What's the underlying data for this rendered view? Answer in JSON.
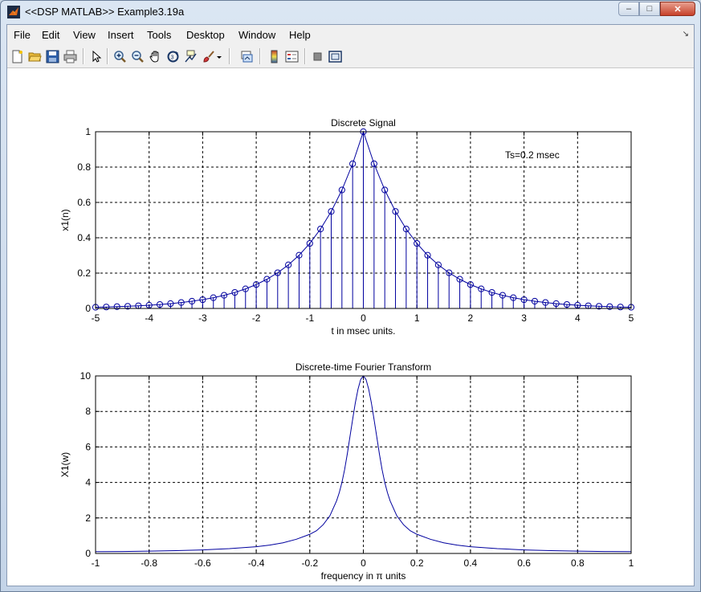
{
  "window": {
    "title": "<<DSP MATLAB>> Example3.19a",
    "controls": {
      "minimize": "–",
      "maximize": "□",
      "close": "✕"
    }
  },
  "menu": {
    "items": [
      "File",
      "Edit",
      "View",
      "Insert",
      "Tools",
      "Desktop",
      "Window",
      "Help"
    ],
    "overflow": "↘"
  },
  "toolbar": {
    "icons": [
      "new-figure-icon",
      "open-file-icon",
      "save-icon",
      "print-icon",
      "pointer-icon",
      "zoom-in-icon",
      "zoom-out-icon",
      "pan-hand-icon",
      "rotate-3d-icon",
      "data-cursor-icon",
      "brush-icon",
      "brush-dropdown-icon",
      "link-plot-icon",
      "colorbar-icon",
      "legend-icon",
      "hide-plot-tools-icon",
      "show-plot-tools-icon"
    ]
  },
  "colors": {
    "line": "#00009e",
    "axes": "#000000",
    "grid": "#000000"
  },
  "chart_data": [
    {
      "type": "stem",
      "title": "Discrete Signal",
      "xlabel": "t in msec units.",
      "ylabel": "x1(n)",
      "xlim": [
        -5,
        5
      ],
      "ylim": [
        0,
        1
      ],
      "xticks": [
        "-5",
        "-4",
        "-3",
        "-2",
        "-1",
        "0",
        "1",
        "2",
        "3",
        "4",
        "5"
      ],
      "yticks": [
        "0",
        "0.2",
        "0.4",
        "0.6",
        "0.8",
        "1"
      ],
      "grid": true,
      "annotation": "Ts=0.2 msec",
      "x": [
        -5.0,
        -4.8,
        -4.6,
        -4.4,
        -4.2,
        -4.0,
        -3.8,
        -3.6,
        -3.4,
        -3.2,
        -3.0,
        -2.8,
        -2.6,
        -2.4,
        -2.2,
        -2.0,
        -1.8,
        -1.6,
        -1.4,
        -1.2,
        -1.0,
        -0.8,
        -0.6,
        -0.4,
        -0.2,
        0.0,
        0.2,
        0.4,
        0.6,
        0.8,
        1.0,
        1.2,
        1.4,
        1.6,
        1.8,
        2.0,
        2.2,
        2.4,
        2.6,
        2.8,
        3.0,
        3.2,
        3.4,
        3.6,
        3.8,
        4.0,
        4.2,
        4.4,
        4.6,
        4.8,
        5.0
      ],
      "y": [
        0.0067,
        0.0082,
        0.0101,
        0.0123,
        0.015,
        0.0183,
        0.0224,
        0.0273,
        0.0334,
        0.0408,
        0.0498,
        0.0608,
        0.0743,
        0.0907,
        0.1108,
        0.1353,
        0.1653,
        0.2019,
        0.2466,
        0.3012,
        0.3679,
        0.4493,
        0.5488,
        0.6703,
        0.8187,
        1.0,
        0.8187,
        0.6703,
        0.5488,
        0.4493,
        0.3679,
        0.3012,
        0.2466,
        0.2019,
        0.1653,
        0.1353,
        0.1108,
        0.0907,
        0.0743,
        0.0608,
        0.0498,
        0.0408,
        0.0334,
        0.0273,
        0.0224,
        0.0183,
        0.015,
        0.0123,
        0.0101,
        0.0082,
        0.0067
      ]
    },
    {
      "type": "line",
      "title": "Discrete-time Fourier Transform",
      "xlabel": "frequency in π units",
      "ylabel": "X1(w)",
      "xlim": [
        -1,
        1
      ],
      "ylim": [
        0,
        10
      ],
      "xticks": [
        "-1",
        "-0.8",
        "-0.6",
        "-0.4",
        "-0.2",
        "0",
        "0.2",
        "0.4",
        "0.6",
        "0.8",
        "1"
      ],
      "yticks": [
        "0",
        "2",
        "4",
        "6",
        "8",
        "10"
      ],
      "grid": true,
      "x": [
        -1.0,
        -0.9,
        -0.8,
        -0.7,
        -0.6,
        -0.5,
        -0.4,
        -0.35,
        -0.3,
        -0.25,
        -0.2,
        -0.175,
        -0.15,
        -0.125,
        -0.1,
        -0.09,
        -0.08,
        -0.07,
        -0.06,
        -0.05,
        -0.04,
        -0.03,
        -0.02,
        -0.01,
        0.0,
        0.01,
        0.02,
        0.03,
        0.04,
        0.05,
        0.06,
        0.07,
        0.08,
        0.09,
        0.1,
        0.125,
        0.15,
        0.175,
        0.2,
        0.25,
        0.3,
        0.35,
        0.4,
        0.5,
        0.6,
        0.7,
        0.8,
        0.9,
        1.0
      ],
      "y": [
        0.1,
        0.11,
        0.13,
        0.16,
        0.2,
        0.27,
        0.38,
        0.47,
        0.6,
        0.8,
        1.08,
        1.28,
        1.62,
        2.12,
        2.96,
        3.42,
        4.0,
        4.72,
        5.6,
        6.58,
        7.55,
        8.48,
        9.25,
        9.8,
        10.0,
        9.8,
        9.25,
        8.48,
        7.55,
        6.58,
        5.6,
        4.72,
        4.0,
        3.42,
        2.96,
        2.12,
        1.62,
        1.28,
        1.08,
        0.8,
        0.6,
        0.47,
        0.38,
        0.27,
        0.2,
        0.16,
        0.13,
        0.11,
        0.1
      ]
    }
  ]
}
